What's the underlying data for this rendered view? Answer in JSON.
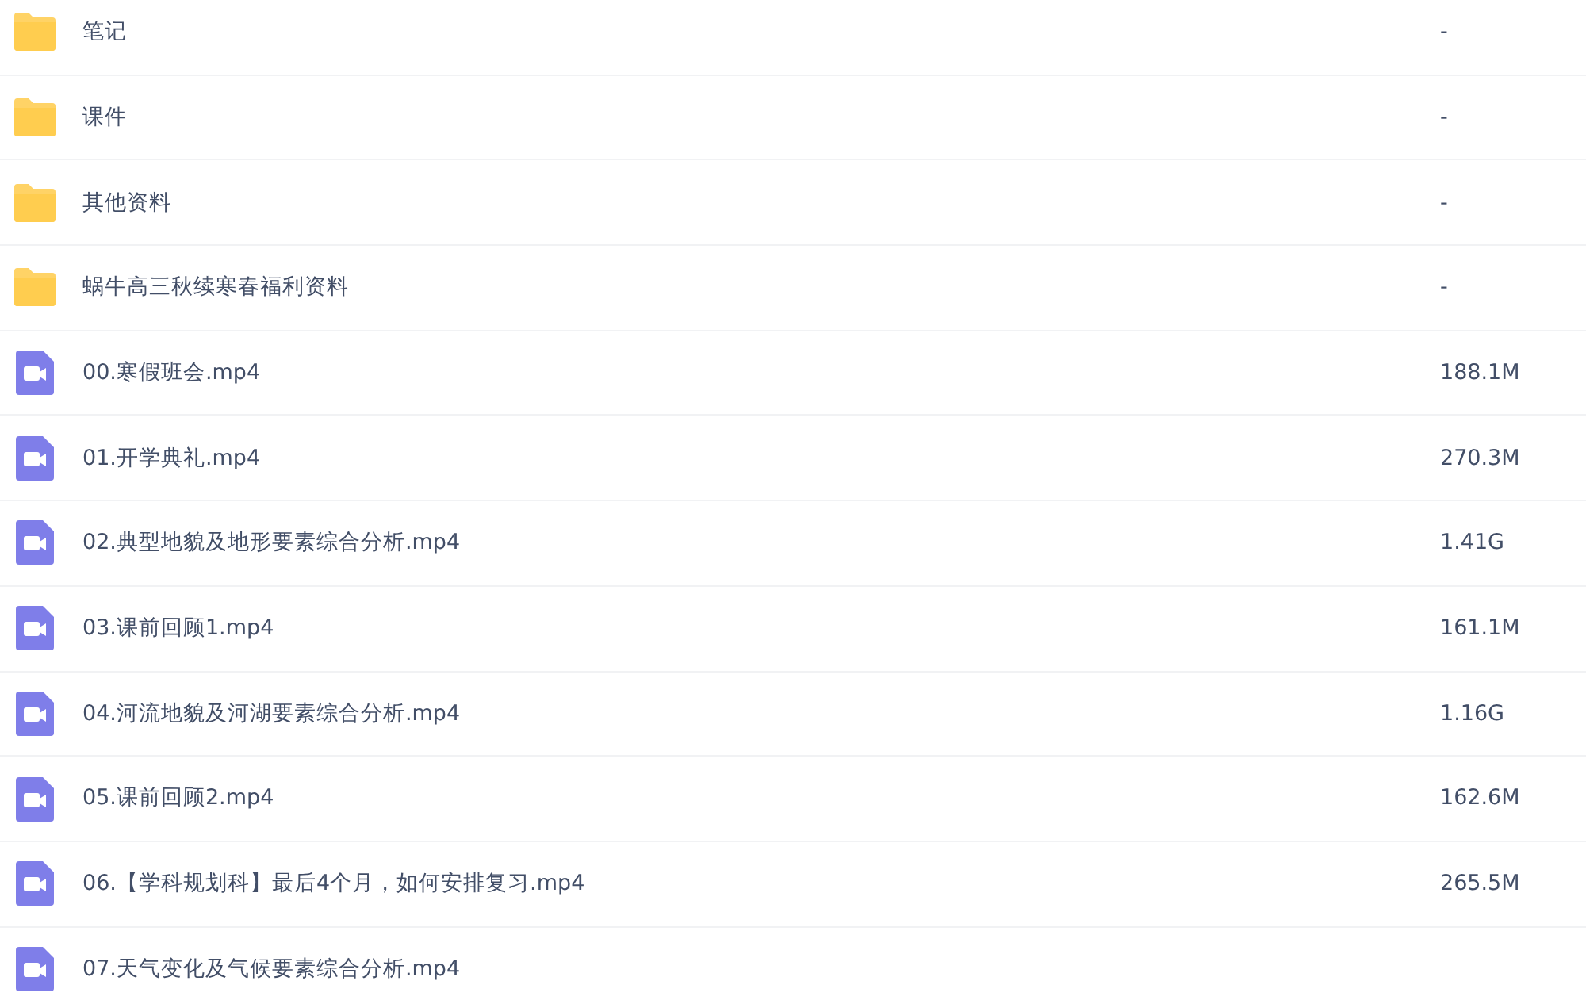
{
  "files": [
    {
      "kind": "folder",
      "name": "笔记",
      "size": "-"
    },
    {
      "kind": "folder",
      "name": "课件",
      "size": "-"
    },
    {
      "kind": "folder",
      "name": "其他资料",
      "size": "-"
    },
    {
      "kind": "folder",
      "name": "蜗牛高三秋续寒春福利资料",
      "size": "-"
    },
    {
      "kind": "video",
      "name": "00.寒假班会.mp4",
      "size": "188.1M"
    },
    {
      "kind": "video",
      "name": "01.开学典礼.mp4",
      "size": "270.3M"
    },
    {
      "kind": "video",
      "name": "02.典型地貌及地形要素综合分析.mp4",
      "size": "1.41G"
    },
    {
      "kind": "video",
      "name": "03.课前回顾1.mp4",
      "size": "161.1M"
    },
    {
      "kind": "video",
      "name": "04.河流地貌及河湖要素综合分析.mp4",
      "size": "1.16G"
    },
    {
      "kind": "video",
      "name": "05.课前回顾2.mp4",
      "size": "162.6M"
    },
    {
      "kind": "video",
      "name": "06.【学科规划科】最后4个月，如何安排复习.mp4",
      "size": "265.5M"
    },
    {
      "kind": "video",
      "name": "07.天气变化及气候要素综合分析.mp4"
    }
  ]
}
